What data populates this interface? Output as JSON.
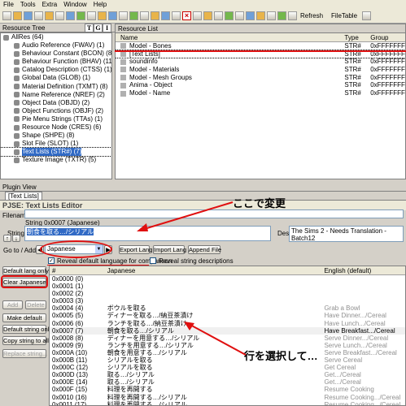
{
  "menu": [
    "File",
    "Tools",
    "Extra",
    "Window",
    "Help"
  ],
  "toolbar": {
    "refresh": "Refresh",
    "filetable": "FileTable"
  },
  "panes": {
    "resource_tree": "Resource Tree",
    "resource_list": "Resource List",
    "plugin_view": "Plugin View"
  },
  "tree_tabs": [
    "T",
    "G",
    "I"
  ],
  "tree_items": [
    {
      "label": "AllRes (64)"
    },
    {
      "label": "Audio Reference (FWAV) (1)"
    },
    {
      "label": "Behaviour Constant (BCON) (8)"
    },
    {
      "label": "Behaviour Function (BHAV) (11)"
    },
    {
      "label": "Catalog Description (CTSS) (1)"
    },
    {
      "label": "Global Data (GLOB) (1)"
    },
    {
      "label": "Material Definition (TXMT) (8)"
    },
    {
      "label": "Name Reference (NREF) (2)"
    },
    {
      "label": "Object Data (OBJD) (2)"
    },
    {
      "label": "Object Functions (OBJF) (2)"
    },
    {
      "label": "Pie Menu Strings (TTAs) (1)"
    },
    {
      "label": "Resource Node (CRES) (6)"
    },
    {
      "label": "Shape (SHPE) (8)"
    },
    {
      "label": "Slot File (SLOT) (1)"
    },
    {
      "label": "Text Lists (STR#) (7)"
    },
    {
      "label": "Texture Image (TXTR) (5)"
    }
  ],
  "resource_list": {
    "headers": [
      "Name",
      "Type",
      "Group"
    ],
    "rows": [
      [
        "Model - Bones",
        "STR#",
        "0xFFFFFFFF"
      ],
      [
        "[Text Lists]",
        "STR#",
        "0xFFFFFFFF"
      ],
      [
        "soundinfo",
        "STR#",
        "0xFFFFFFFF"
      ],
      [
        "Model - Materials",
        "STR#",
        "0xFFFFFFFF"
      ],
      [
        "Model - Mesh Groups",
        "STR#",
        "0xFFFFFFFF"
      ],
      [
        "Anima - Object",
        "STR#",
        "0xFFFFFFFF"
      ],
      [
        "Model - Name",
        "STR#",
        "0xFFFFFFFF"
      ]
    ]
  },
  "plugin_tab": "[Text Lists]",
  "editor": {
    "title": "PJSE: Text Lists Editor",
    "filename_label": "Filename",
    "string_caption": "String 0x0007 (Japanese)",
    "string_label": "String",
    "string_value": "朝食を取る…/シリアル",
    "desc_label": "Desc",
    "desc_value": "The Sims 2 - Needs Translation - Batch12",
    "goto_label": "Go to / Add",
    "language": "Japanese",
    "export_lang": "Export Lang",
    "import_lang": "Import Lang",
    "append_file": "Append File",
    "reveal_default": "Reveal default language for comparison",
    "reveal_desc": "Reveal string descriptions",
    "buttons": {
      "default_lang_only": "Default lang only",
      "clear_japanese": "Clear Japanese",
      "add": "Add",
      "delete": "Delete",
      "make_default": "Make default",
      "default_string_only": "Default string only",
      "copy_string_to_all": "Copy string to all",
      "replace_string": "Replace string..."
    }
  },
  "grid": {
    "headers": [
      "#",
      "Japanese",
      "English (default)"
    ],
    "rows": [
      [
        "0x0000 (0)",
        "",
        ""
      ],
      [
        "0x0001 (1)",
        "",
        ""
      ],
      [
        "0x0002 (2)",
        "",
        ""
      ],
      [
        "0x0003 (3)",
        "",
        ""
      ],
      [
        "0x0004 (4)",
        "ボウルを取る",
        "Grab a Bowl"
      ],
      [
        "0x0005 (5)",
        "ディナーを取る…/納豆茶漬け",
        "Have Dinner.../Cereal"
      ],
      [
        "0x0006 (6)",
        "ランチを取る…/納豆茶漬け",
        "Have Lunch.../Cereal"
      ],
      [
        "0x0007 (7)",
        "朝食を取る…/シリアル",
        "Have Breakfast.../Cereal"
      ],
      [
        "0x0008 (8)",
        "ディナーを用意する…/シリアル",
        "Serve Dinner.../Cereal"
      ],
      [
        "0x0009 (9)",
        "ランチを用意する…/シリアル",
        "Serve Lunch.../Cereal"
      ],
      [
        "0x000A (10)",
        "朝食を用意する…/シリアル",
        "Serve Breakfast.../Cereal"
      ],
      [
        "0x000B (11)",
        "シリアルを取る",
        "Serve Cereal"
      ],
      [
        "0x000C (12)",
        "シリアルを取る",
        "Get Cereal"
      ],
      [
        "0x000D (13)",
        "取る…/シリアル",
        "Get.../Cereal"
      ],
      [
        "0x000E (14)",
        "取る…/シリアル",
        "Get.../Cereal"
      ],
      [
        "0x000F (15)",
        "料理を再開する",
        "Resume Cooking"
      ],
      [
        "0x0010 (16)",
        "料理を再開する…/シリアル",
        "Resume Cooking.../Cereal"
      ],
      [
        "0x0011 (17)",
        "料理を再開する…/シリアル",
        "Resume Cooking.../Cereal"
      ]
    ]
  },
  "annotations": {
    "change_here": "ここで変更",
    "select_row": "行を選択して…"
  },
  "colors": {
    "annotation_red": "#e01010",
    "selection_blue": "#316ac5"
  }
}
